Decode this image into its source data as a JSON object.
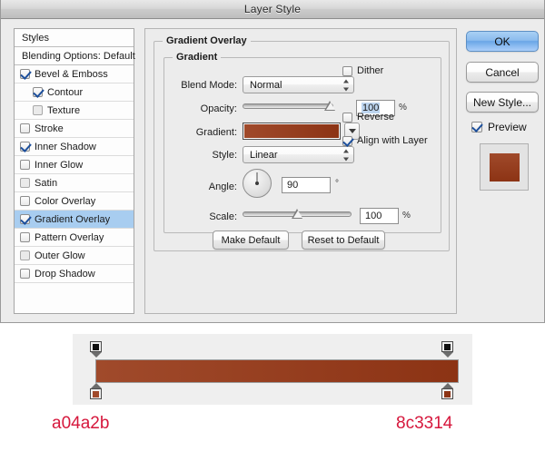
{
  "window": {
    "title": "Layer Style"
  },
  "styles_panel": {
    "items": [
      {
        "label": "Styles",
        "checkbox": "none",
        "indent": 0,
        "selected": false
      },
      {
        "label": "Blending Options: Default",
        "checkbox": "none",
        "indent": 0,
        "selected": false
      },
      {
        "label": "Bevel & Emboss",
        "checkbox": "checked",
        "indent": 0,
        "selected": false
      },
      {
        "label": "Contour",
        "checkbox": "checked",
        "indent": 1,
        "selected": false
      },
      {
        "label": "Texture",
        "checkbox": "unchecked-dim",
        "indent": 1,
        "selected": false
      },
      {
        "label": "Stroke",
        "checkbox": "unchecked",
        "indent": 0,
        "selected": false
      },
      {
        "label": "Inner Shadow",
        "checkbox": "checked",
        "indent": 0,
        "selected": false
      },
      {
        "label": "Inner Glow",
        "checkbox": "unchecked",
        "indent": 0,
        "selected": false
      },
      {
        "label": "Satin",
        "checkbox": "unchecked-dim",
        "indent": 0,
        "selected": false
      },
      {
        "label": "Color Overlay",
        "checkbox": "unchecked",
        "indent": 0,
        "selected": false
      },
      {
        "label": "Gradient Overlay",
        "checkbox": "checked",
        "indent": 0,
        "selected": true
      },
      {
        "label": "Pattern Overlay",
        "checkbox": "unchecked",
        "indent": 0,
        "selected": false
      },
      {
        "label": "Outer Glow",
        "checkbox": "unchecked-dim",
        "indent": 0,
        "selected": false
      },
      {
        "label": "Drop Shadow",
        "checkbox": "unchecked",
        "indent": 0,
        "selected": false
      }
    ]
  },
  "settings": {
    "section_title": "Gradient Overlay",
    "group_title": "Gradient",
    "blend_mode": {
      "label": "Blend Mode:",
      "value": "Normal"
    },
    "opacity": {
      "label": "Opacity:",
      "value": "100",
      "unit": "%",
      "slider_percent": 100
    },
    "gradient": {
      "label": "Gradient:",
      "from": "#a04a2b",
      "to": "#8c3314"
    },
    "style": {
      "label": "Style:",
      "value": "Linear"
    },
    "angle": {
      "label": "Angle:",
      "value": "90",
      "unit": "°"
    },
    "scale": {
      "label": "Scale:",
      "value": "100",
      "unit": "%",
      "slider_percent": 50
    },
    "dither": {
      "label": "Dither",
      "checked": false
    },
    "reverse": {
      "label": "Reverse",
      "checked": false
    },
    "align_with_layer": {
      "label": "Align with Layer",
      "checked": true
    },
    "make_default": "Make Default",
    "reset_to_default": "Reset to Default"
  },
  "buttons": {
    "ok": "OK",
    "cancel": "Cancel",
    "new_style": "New Style...",
    "preview": {
      "label": "Preview",
      "checked": true
    },
    "thumbnail_color_from": "#a04a2b",
    "thumbnail_color_to": "#8c3314"
  },
  "gradient_editor": {
    "bar_from": "#a04a2b",
    "bar_to": "#8c3314",
    "opacity_stops": [
      {
        "position_percent": 0,
        "color": "#111111"
      },
      {
        "position_percent": 100,
        "color": "#111111"
      }
    ],
    "color_stops": [
      {
        "position_percent": 0,
        "color": "#a04a2b"
      },
      {
        "position_percent": 100,
        "color": "#8c3314"
      }
    ]
  },
  "annotations": {
    "left_hex": "a04a2b",
    "right_hex": "8c3314",
    "hex_text_color": "#d6173c"
  }
}
